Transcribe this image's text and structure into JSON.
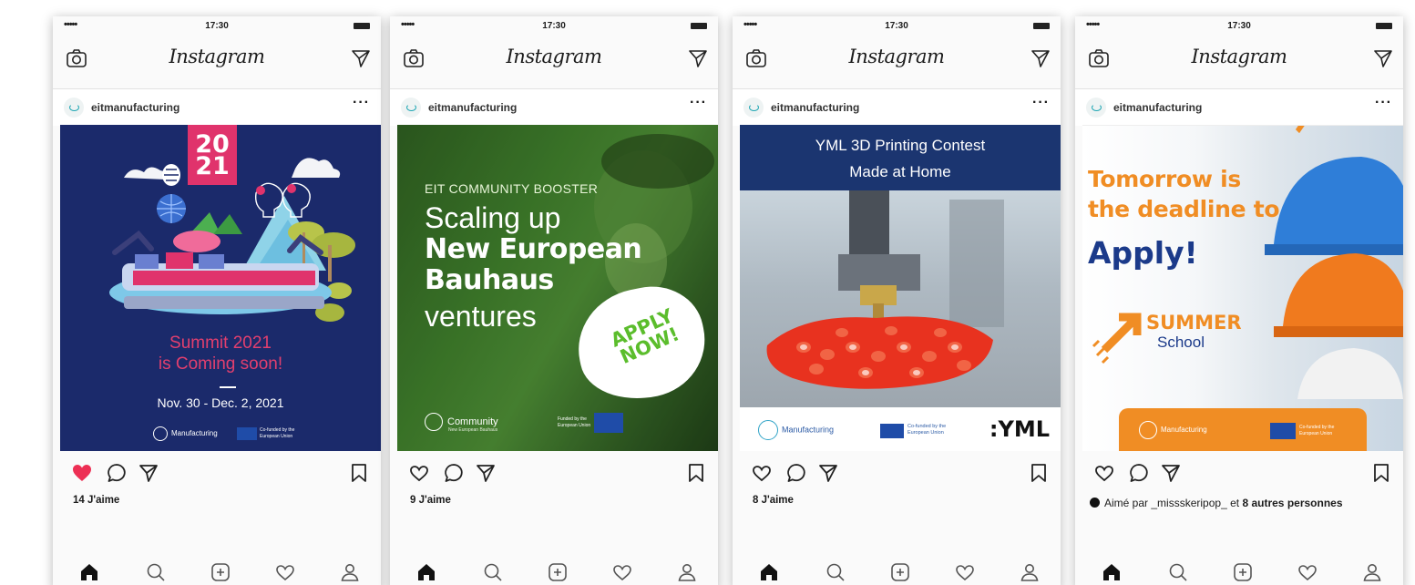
{
  "status": {
    "signal": "•••••",
    "time": "17:30"
  },
  "app": {
    "title": "Instagram"
  },
  "posts": [
    {
      "user": "eitmanufacturing",
      "more": "···",
      "liked": true,
      "likes": "14 J'aime",
      "image": {
        "year": "20 21",
        "caption_line1": "Summit 2021",
        "caption_line2": "is Coming soon!",
        "dates": "Nov. 30 - Dec. 2, 2021",
        "logo_text": "Manufacturing",
        "eu_text": "Co-funded by the European Union"
      }
    },
    {
      "user": "eitmanufacturing",
      "more": "···",
      "liked": false,
      "likes": "9 J'aime",
      "image": {
        "kicker": "EIT COMMUNITY BOOSTER",
        "line1": "Scaling up",
        "line2": "New European",
        "line3": "Bauhaus",
        "line4": "ventures",
        "cta": "APPLY NOW!",
        "logo_text": "Community",
        "logo_sub": "New European Bauhaus",
        "funded": "Funded by the European Union"
      }
    },
    {
      "user": "eitmanufacturing",
      "more": "···",
      "liked": false,
      "likes": "8 J'aime",
      "image": {
        "header_line1": "YML 3D Printing Contest",
        "header_line2": "Made at Home",
        "logo_text": "Manufacturing",
        "eu_text": "Co-funded by the European Union",
        "brand": ":YML"
      }
    },
    {
      "user": "eitmanufacturing",
      "more": "···",
      "liked": false,
      "likes_prefix": "Aimé par",
      "likes_user": "_missskeripop_",
      "likes_mid": "et",
      "likes_rest": "8 autres personnes",
      "image": {
        "line1": "Tomorrow is",
        "line2": "the deadline to",
        "line3": "Apply!",
        "summer": "SUMMER",
        "school": "School",
        "logo_text": "Manufacturing",
        "eu_text": "Co-funded by the European Union"
      }
    }
  ],
  "colors": {
    "like_red": "#ed2f54",
    "accent_orange": "#f08d24",
    "eit_navy": "#1b2a6b",
    "nav_blue": "#1b3570"
  },
  "icons": [
    "camera-icon",
    "send-icon",
    "heart-icon",
    "comment-icon",
    "share-icon",
    "bookmark-icon",
    "home-icon",
    "search-icon",
    "add-icon",
    "activity-icon",
    "profile-icon"
  ]
}
